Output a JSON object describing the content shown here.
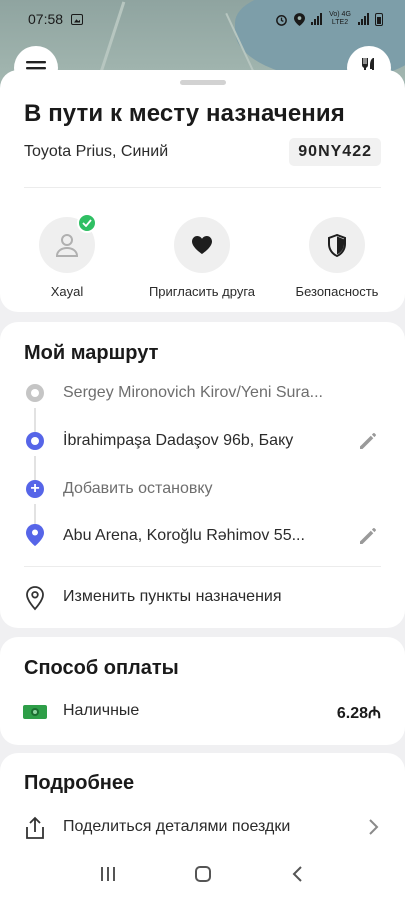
{
  "status_bar": {
    "time": "07:58",
    "network_label": "Vo) 4G LTE2"
  },
  "map": {
    "left_button_icon": "menu-icon",
    "right_button_icon": "fork-knife-icon"
  },
  "trip": {
    "title": "В пути к месту назначения",
    "car": "Toyota Prius, Синий",
    "plate": "90NY422"
  },
  "actions": [
    {
      "label": "Xayal",
      "icon": "user-icon",
      "verified": true
    },
    {
      "label": "Пригласить друга",
      "icon": "heart-icon"
    },
    {
      "label": "Безопасность",
      "icon": "shield-icon"
    }
  ],
  "route": {
    "title": "Мой маршрут",
    "stops": [
      {
        "text": "Sergey Mironovich Kirov/Yeni Sura...",
        "type": "origin",
        "editable": false
      },
      {
        "text": "İbrahimpaşa Dadaşov 96b, Баку",
        "type": "stop",
        "editable": true
      },
      {
        "text": "Добавить остановку",
        "type": "add",
        "editable": false
      },
      {
        "text": "Abu Arena, Koroğlu Rəhimov 55...",
        "type": "destination",
        "editable": true
      }
    ],
    "change_label": "Изменить пункты назначения"
  },
  "payment": {
    "title": "Способ оплаты",
    "method": "Наличные",
    "amount": "6.28₼",
    "colors": {
      "cash_icon": "#2e9e48"
    }
  },
  "details": {
    "title": "Подробнее",
    "share_label": "Поделиться деталями поездки"
  },
  "colors": {
    "accent": "#5665e8",
    "verified": "#2fbf63"
  }
}
